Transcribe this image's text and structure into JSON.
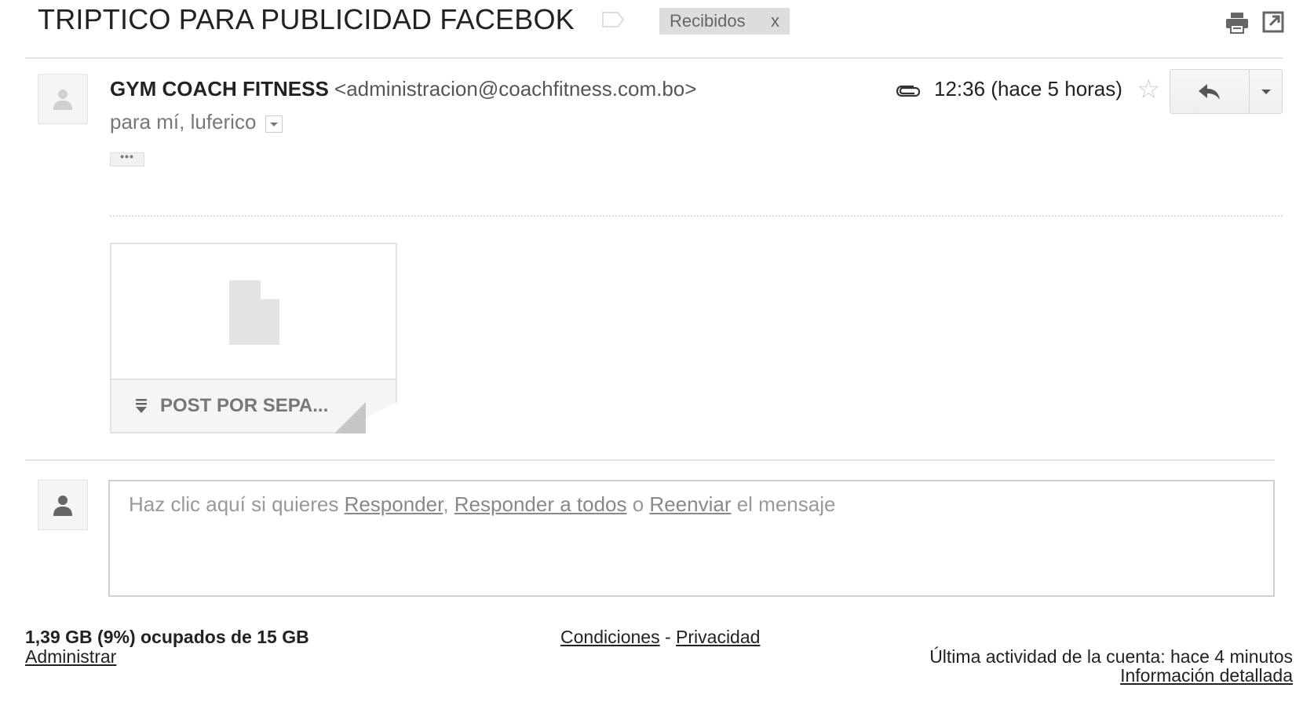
{
  "thread": {
    "subject": "TRIPTICO PARA PUBLICIDAD FACEBOK",
    "label_chip": {
      "text": "Recibidos",
      "remove": "x"
    }
  },
  "message": {
    "sender_name": "GYM COACH FITNESS",
    "sender_email": "<administracion@coachfitness.com.bo>",
    "recipients": "para mí, luferico",
    "ellipsis": "•••",
    "time": "12:36 (hace 5 horas)",
    "star_glyph": "☆"
  },
  "attachment": {
    "name": "POST POR SEPA..."
  },
  "reply_prompt": {
    "prefix": "Haz clic aquí si quieres ",
    "reply": "Responder",
    "sep1": ", ",
    "reply_all": "Responder a todos",
    "sep2": " o ",
    "forward": "Reenviar",
    "suffix": " el mensaje"
  },
  "footer": {
    "storage": "1,39 GB (9%) ocupados de 15 GB",
    "manage": "Administrar",
    "terms": "Condiciones",
    "legal_sep": " - ",
    "privacy": "Privacidad",
    "last_activity": "Última actividad de la cuenta: hace 4 minutos",
    "details": "Información detallada"
  },
  "icons": {
    "label": "label-outline-icon",
    "print": "printer-icon",
    "new_window": "open-in-new-window-icon",
    "avatar": "person-silhouette-icon",
    "attachment": "paperclip-icon",
    "star": "star-outline-icon",
    "reply": "reply-arrow-icon",
    "more": "caret-down-icon",
    "file": "document-icon",
    "download": "download-icon"
  }
}
